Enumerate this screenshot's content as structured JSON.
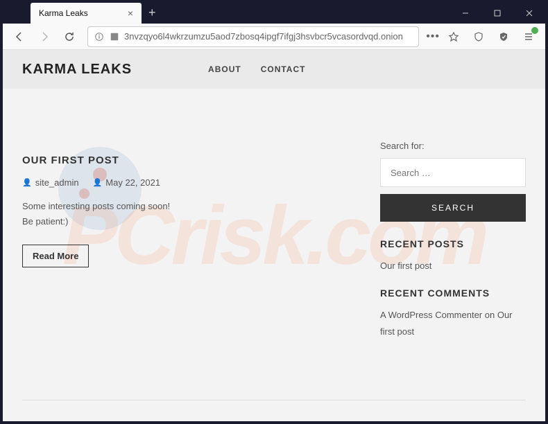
{
  "browser": {
    "tab_title": "Karma Leaks",
    "url": "3nvzqyo6l4wkrzumzu5aod7zbosq4ipgf7ifgj3hsvbcr5vcasordvqd.onion"
  },
  "header": {
    "title": "KARMA LEAKS",
    "nav": {
      "about": "ABOUT",
      "contact": "CONTACT"
    }
  },
  "post": {
    "title": "OUR FIRST POST",
    "author": "site_admin",
    "date": "May 22, 2021",
    "excerpt_line1": "Some interesting posts coming soon!",
    "excerpt_line2": "Be patient:)",
    "read_more": "Read More"
  },
  "sidebar": {
    "search_label": "Search for:",
    "search_placeholder": "Search …",
    "search_button": "SEARCH",
    "recent_posts_title": "RECENT POSTS",
    "recent_posts": {
      "item1": "Our first post"
    },
    "recent_comments_title": "RECENT COMMENTS",
    "recent_comments": {
      "commenter": "A WordPress Commenter",
      "on": " on ",
      "post": "Our first post"
    }
  },
  "watermark": "PCrisk.com"
}
